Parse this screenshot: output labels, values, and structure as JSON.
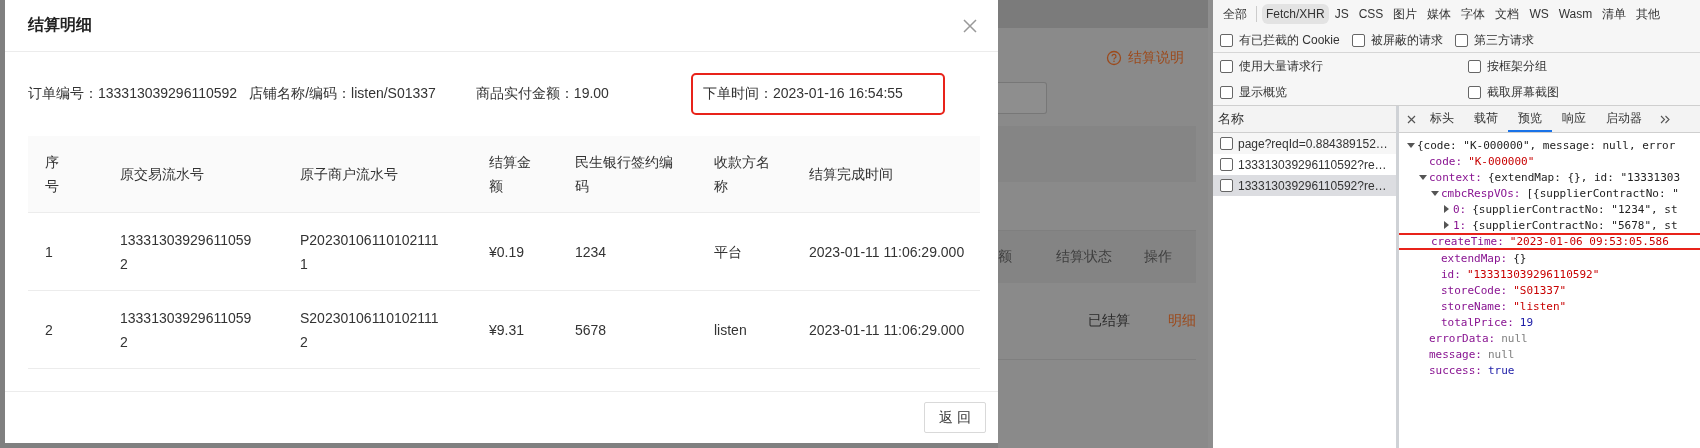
{
  "modal": {
    "title": "结算明细",
    "info": [
      {
        "text": "订单编号：133313039296110592",
        "highlighted": false
      },
      {
        "text": "店铺名称/编码：listen/S01337",
        "highlighted": false
      },
      {
        "text": "商品实付金额：19.00",
        "highlighted": false
      },
      {
        "text": "下单时间：2023-01-16 16:54:55",
        "highlighted": true
      }
    ],
    "table": {
      "columns": [
        "序号",
        "原交易流水号",
        "原子商户流水号",
        "结算金额",
        "民生银行签约编码",
        "收款方名称",
        "结算完成时间"
      ],
      "rows": [
        [
          "1",
          "133313039296110592",
          "P202301061101021111",
          "¥0.19",
          "1234",
          "平台",
          "2023-01-11 11:06:29.000"
        ],
        [
          "2",
          "133313039296110592",
          "S202301061101021112",
          "¥9.31",
          "5678",
          "listen",
          "2023-01-11 11:06:29.000"
        ]
      ]
    },
    "buttons": [
      "返 回"
    ]
  },
  "background_page": {
    "help_link": "结算说明",
    "columns": [
      "额",
      "结算状态",
      "操作"
    ],
    "row": {
      "status": "已结算",
      "action": "明细"
    }
  },
  "devtools": {
    "filters": [
      {
        "label": "全部",
        "selected": false
      },
      {
        "label": "Fetch/XHR",
        "selected": true
      },
      {
        "label": "JS",
        "selected": false
      },
      {
        "label": "CSS",
        "selected": false
      },
      {
        "label": "图片",
        "selected": false
      },
      {
        "label": "媒体",
        "selected": false
      },
      {
        "label": "字体",
        "selected": false
      },
      {
        "label": "文档",
        "selected": false
      },
      {
        "label": "WS",
        "selected": false
      },
      {
        "label": "Wasm",
        "selected": false
      },
      {
        "label": "清单",
        "selected": false
      },
      {
        "label": "其他",
        "selected": false
      }
    ],
    "inline_options": [
      {
        "label": "有已拦截的 Cookie",
        "checked": false
      },
      {
        "label": "被屏蔽的请求",
        "checked": false
      },
      {
        "label": "第三方请求",
        "checked": false
      }
    ],
    "settings": [
      {
        "label": "使用大量请求行",
        "checked": false
      },
      {
        "label": "按框架分组",
        "checked": false
      },
      {
        "label": "显示概览",
        "checked": false
      },
      {
        "label": "截取屏幕截图",
        "checked": false
      }
    ],
    "name_header": "名称",
    "requests": [
      {
        "name": "page?reqId=0.884389152…",
        "selected": false
      },
      {
        "name": "133313039296110592?re…",
        "selected": false
      },
      {
        "name": "133313039296110592?re…",
        "selected": true
      }
    ],
    "tabs": [
      {
        "label": "标头",
        "selected": false
      },
      {
        "label": "载荷",
        "selected": false
      },
      {
        "label": "预览",
        "selected": true
      },
      {
        "label": "响应",
        "selected": false
      },
      {
        "label": "启动器",
        "selected": false
      }
    ],
    "preview": {
      "summary": "{code: \"K-000000\", message: null, error",
      "expanded": true,
      "children": [
        {
          "key": "code:",
          "value": "\"K-000000\"",
          "kind": "string"
        },
        {
          "key": "context:",
          "value": "{extendMap: {}, id: \"13331303",
          "kind": "object",
          "expanded": true,
          "children": [
            {
              "key": "cmbcRespVOs:",
              "value": "[{supplierContractNo: \"",
              "kind": "object",
              "expanded": true,
              "children": [
                {
                  "key": "0:",
                  "value": "{supplierContractNo: \"1234\", st",
                  "kind": "object",
                  "expanded": false
                },
                {
                  "key": "1:",
                  "value": "{supplierContractNo: \"5678\", st",
                  "kind": "object",
                  "expanded": false
                }
              ]
            },
            {
              "key": "createTime:",
              "value": "\"2023-01-06 09:53:05.586",
              "kind": "string",
              "highlighted": true
            },
            {
              "key": "extendMap:",
              "value": "{}",
              "kind": "object"
            },
            {
              "key": "id:",
              "value": "\"133313039296110592\"",
              "kind": "string"
            },
            {
              "key": "storeCode:",
              "value": "\"S01337\"",
              "kind": "string"
            },
            {
              "key": "storeName:",
              "value": "\"listen\"",
              "kind": "string"
            },
            {
              "key": "totalPrice:",
              "value": "19",
              "kind": "number"
            }
          ]
        },
        {
          "key": "errorData:",
          "value": "null",
          "kind": "null"
        },
        {
          "key": "message:",
          "value": "null",
          "kind": "null"
        },
        {
          "key": "success:",
          "value": "true",
          "kind": "boolean"
        }
      ]
    }
  }
}
